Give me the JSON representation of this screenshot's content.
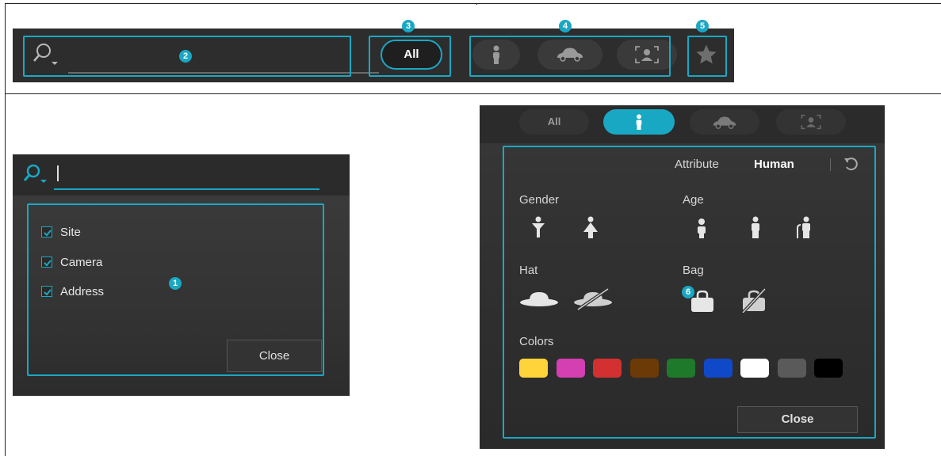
{
  "callouts": {
    "c1": "1",
    "c2": "2",
    "c3": "3",
    "c4": "4",
    "c5": "5",
    "c6": "6"
  },
  "toolbar": {
    "all_label": "All",
    "filters": [
      "person-filter-icon",
      "vehicle-filter-icon",
      "face-filter-icon"
    ],
    "favorite_icon": "star-icon"
  },
  "search_panel": {
    "input_value": "",
    "options": [
      {
        "label": "Site",
        "checked": true
      },
      {
        "label": "Camera",
        "checked": true
      },
      {
        "label": "Address",
        "checked": true
      }
    ],
    "close_label": "Close"
  },
  "attr_panel": {
    "tabs": {
      "all_label": "All"
    },
    "header_prefix": "Attribute",
    "header_value": "Human",
    "gender_label": "Gender",
    "age_label": "Age",
    "hat_label": "Hat",
    "bag_label": "Bag",
    "colors_label": "Colors",
    "colors": [
      "#ffd43b",
      "#d43fb2",
      "#d33131",
      "#6b3a06",
      "#1e7a2a",
      "#1049c8",
      "#ffffff",
      "#5a5a5a",
      "#000000"
    ],
    "close_label": "Close"
  },
  "accent": "#19a8c4"
}
